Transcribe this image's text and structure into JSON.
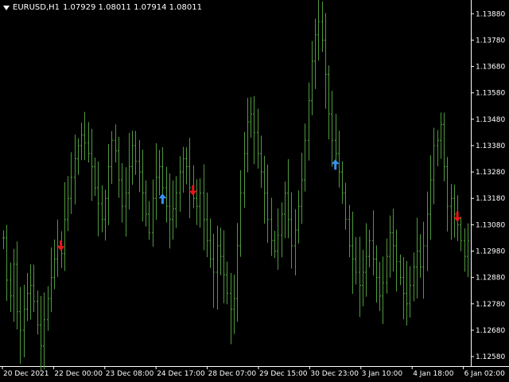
{
  "header": {
    "symbol": "EURUSD,H1",
    "ohlc": "1.07929 1.08011 1.07914 1.08011"
  },
  "colors": {
    "background": "#000000",
    "axis": "#ffffff",
    "bars": "#4f9a3c",
    "sell_arrow": "#e8141b",
    "buy_arrow": "#3a8ff5"
  },
  "icons": {
    "sell": "down-arrow-icon",
    "buy": "up-arrow-icon",
    "menu": "triangle-down-icon"
  },
  "chart_data": {
    "type": "bar",
    "title": "EURUSD,H1",
    "series_price": [
      1.1303,
      1.1287,
      1.1281,
      1.1293,
      1.1275,
      1.1268,
      1.1276,
      1.1282,
      1.1285,
      1.1279,
      1.127,
      1.1262,
      1.1272,
      1.128,
      1.1288,
      1.1295,
      1.13,
      1.1297,
      1.131,
      1.1318,
      1.1326,
      1.1333,
      1.1338,
      1.1342,
      1.1339,
      1.1335,
      1.133,
      1.1322,
      1.1316,
      1.131,
      1.1318,
      1.133,
      1.134,
      1.1336,
      1.1325,
      1.1315,
      1.132,
      1.133,
      1.1338,
      1.1332,
      1.1328,
      1.132,
      1.1312,
      1.1305,
      1.1318,
      1.1326,
      1.133,
      1.1322,
      1.1315,
      1.131,
      1.1314,
      1.132,
      1.1328,
      1.1333,
      1.133,
      1.1322,
      1.1318,
      1.1315,
      1.132,
      1.131,
      1.1302,
      1.1295,
      1.129,
      1.13,
      1.1296,
      1.1289,
      1.1282,
      1.1276,
      1.128,
      1.13,
      1.132,
      1.1335,
      1.1347,
      1.135,
      1.1343,
      1.1335,
      1.1328,
      1.132,
      1.131,
      1.1302,
      1.1298,
      1.1304,
      1.1312,
      1.132,
      1.131,
      1.13,
      1.1306,
      1.1315,
      1.1325,
      1.134,
      1.1355,
      1.137,
      1.138,
      1.1385,
      1.1378,
      1.1365,
      1.135,
      1.134,
      1.1335,
      1.1328,
      1.132,
      1.131,
      1.13,
      1.1295,
      1.129,
      1.1285,
      1.129,
      1.1296,
      1.1302,
      1.1295,
      1.1288,
      1.1281,
      1.1286,
      1.1296,
      1.1305,
      1.13,
      1.1294,
      1.1288,
      1.1282,
      1.1278,
      1.1285,
      1.1292,
      1.1298,
      1.1292,
      1.13,
      1.1312,
      1.1325,
      1.1338,
      1.134,
      1.1346,
      1.133,
      1.1315,
      1.1318,
      1.1312,
      1.1308,
      1.1302,
      1.1296,
      1.1302
    ],
    "ohlc_latest": {
      "open": 1.07929,
      "high": 1.08011,
      "low": 1.07914,
      "close": 1.08011
    },
    "y_tick_labels": [
      "1.13880",
      "1.13780",
      "1.13680",
      "1.13580",
      "1.13480",
      "1.13380",
      "1.13280",
      "1.13180",
      "1.13080",
      "1.12980",
      "1.12880",
      "1.12780",
      "1.12680",
      "1.12580"
    ],
    "x_tick_labels": [
      "20 Dec 2021",
      "22 Dec 00:00",
      "23 Dec 08:00",
      "24 Dec 17:00",
      "28 Dec 07:00",
      "29 Dec 15:00",
      "30 Dec 23:00",
      "3 Jan 10:00",
      "4 Jan 18:00",
      "6 Jan 02:00"
    ],
    "ylim": [
      1.1255,
      1.1392
    ],
    "signals": [
      {
        "type": "sell",
        "index": 17
      },
      {
        "type": "buy",
        "index": 47
      },
      {
        "type": "sell",
        "index": 56
      },
      {
        "type": "buy",
        "index": 98
      },
      {
        "type": "sell",
        "index": 134
      }
    ],
    "grid": false,
    "legend": "none"
  }
}
